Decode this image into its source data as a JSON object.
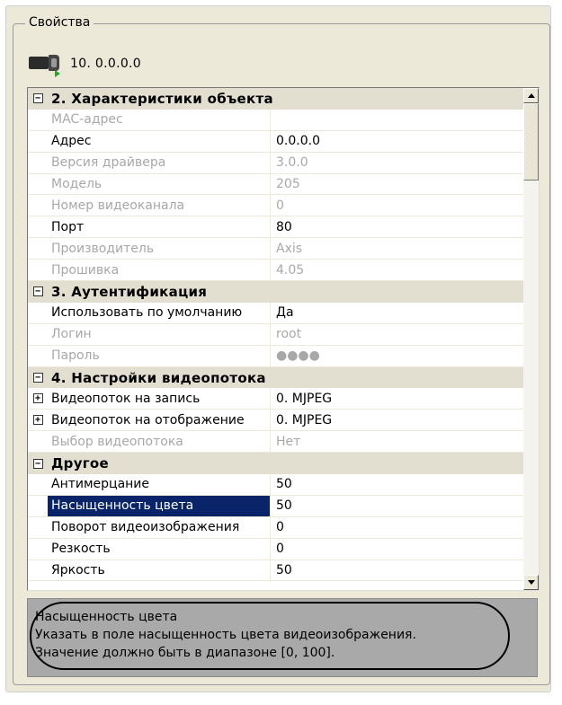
{
  "panel": {
    "title": "Свойства"
  },
  "device": {
    "label": "10. 0.0.0.0",
    "icon": "camera-icon"
  },
  "grid": {
    "sections": [
      {
        "key": "s2",
        "label": "2. Характеристики объекта",
        "expanded": true,
        "rows": [
          {
            "name": "MAC-адрес",
            "value": "",
            "readonly": true
          },
          {
            "name": "Адрес",
            "value": "0.0.0.0",
            "readonly": false
          },
          {
            "name": "Версия драйвера",
            "value": "3.0.0",
            "readonly": true
          },
          {
            "name": "Модель",
            "value": "205",
            "readonly": true
          },
          {
            "name": "Номер видеоканала",
            "value": "0",
            "readonly": true
          },
          {
            "name": "Порт",
            "value": "80",
            "readonly": false
          },
          {
            "name": "Производитель",
            "value": "Axis",
            "readonly": true
          },
          {
            "name": "Прошивка",
            "value": "4.05",
            "readonly": true
          }
        ]
      },
      {
        "key": "s3",
        "label": "3. Аутентификация",
        "expanded": true,
        "rows": [
          {
            "name": "Использовать по умолчанию",
            "value": "Да",
            "readonly": false
          },
          {
            "name": "Логин",
            "value": "root",
            "readonly": true
          },
          {
            "name": "Пароль",
            "value": "●●●●",
            "readonly": true
          }
        ]
      },
      {
        "key": "s4",
        "label": "4. Настройки видеопотока",
        "expanded": true,
        "rows": [
          {
            "name": "Видеопоток на запись",
            "value": "0. MJPEG",
            "readonly": false,
            "expandable": true
          },
          {
            "name": "Видеопоток на отображение",
            "value": "0. MJPEG",
            "readonly": false,
            "expandable": true
          },
          {
            "name": "Выбор видеопотока",
            "value": "Нет",
            "readonly": true
          }
        ]
      },
      {
        "key": "s5",
        "label": "Другое",
        "expanded": true,
        "rows": [
          {
            "name": "Антимерцание",
            "value": "50",
            "readonly": false
          },
          {
            "name": "Насыщенность цвета",
            "value": "50",
            "readonly": false,
            "selected": true
          },
          {
            "name": "Поворот видеоизображения",
            "value": "0",
            "readonly": false
          },
          {
            "name": "Резкость",
            "value": "0",
            "readonly": false
          },
          {
            "name": "Яркость",
            "value": "50",
            "readonly": false
          }
        ]
      }
    ],
    "scroll_position": 0.0
  },
  "help": {
    "title": "Насыщенность цвета",
    "text": "Указать в поле насыщенность цвета видеоизображения.\nЗначение должно быть в диапазоне [0, 100]."
  },
  "colors": {
    "selection": "#0a246a",
    "category_bg": "#e3dfd0",
    "readonly_text": "#a8a8a8",
    "help_bg": "#a9a9a9"
  }
}
